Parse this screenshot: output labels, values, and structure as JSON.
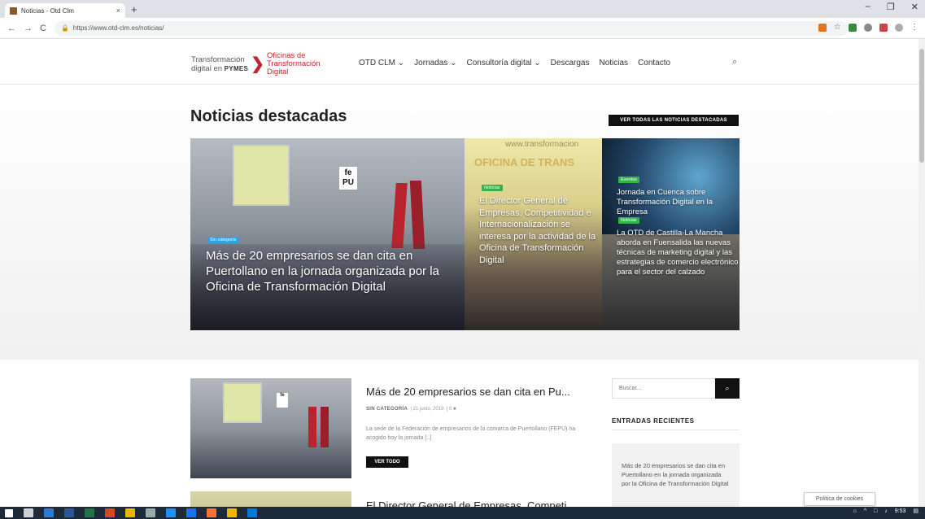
{
  "browser": {
    "tab_title": "Noticias - Otd Clm",
    "tab_close": "×",
    "new_tab": "+",
    "url": "https://www.otd-clm.es/noticias/",
    "window_controls": [
      "–",
      "❐",
      "✕"
    ]
  },
  "logo": {
    "left_line1": "Transformación",
    "left_line2": "digital en",
    "left_bold": "PYMES",
    "right_line1": "Oficinas de",
    "right_line2": "Transformación",
    "right_line3": "Digital"
  },
  "nav": [
    {
      "label": "OTD CLM ⌄"
    },
    {
      "label": "Jornadas ⌄"
    },
    {
      "label": "Consultoría digital ⌄"
    },
    {
      "label": "Descargas"
    },
    {
      "label": "Noticias"
    },
    {
      "label": "Contacto"
    }
  ],
  "featured": {
    "heading": "Noticias destacadas",
    "see_all": "VER TODAS LAS NOTICIAS DESTACADAS",
    "big": {
      "category": "Sin categoría",
      "title": "Más de 20 empresarios se dan cita en Puertollano en la jornada organizada por la Oficina de Transformación Digital"
    },
    "mid": {
      "category": "Noticias",
      "title": "El Director General de Empresas, Competitividad e Internacionalización se interesa por la actividad de la Oficina de Transformación Digital",
      "bg_text": "OFICINA DE TRANS",
      "bg_url": "www.transformacion"
    },
    "right_top": {
      "category": "Eventos",
      "title": "Jornada en Cuenca sobre Transformación Digital en la Empresa"
    },
    "right_bottom": {
      "category": "Noticias",
      "title": "La OTD de Castilla-La Mancha aborda en Fuensalida las nuevas técnicas de marketing digital y las estrategias de comercio electrónico para el sector del calzado"
    }
  },
  "posts": [
    {
      "title": "Más de 20 empresarios se dan cita en Pu...",
      "category": "SIN CATEGORÍA",
      "date": "21 junio, 2019",
      "comments": "0",
      "excerpt": "La sede de la Federación de empresarios de la comarca de Puertollano (FEPU) ha acogido hoy   la jornada [..]",
      "read_more": "VER TODO"
    },
    {
      "title": "El Director General de Empresas, Competi..."
    }
  ],
  "sidebar": {
    "search_placeholder": "Buscar...",
    "recent_heading": "ENTRADAS RECIENTES",
    "recent_items": [
      "Más de 20 empresarios se dan cita en Puertollano en la jornada organizada por la Oficina de Transformación Digital"
    ]
  },
  "cookie_label": "Política de cookies",
  "tray": {
    "time": "9:53"
  },
  "colors": {
    "accent_red": "#c0262b",
    "badge_blue": "#2aa5e0",
    "badge_green": "#36b24a",
    "taskbar": "#1c2a3a"
  }
}
